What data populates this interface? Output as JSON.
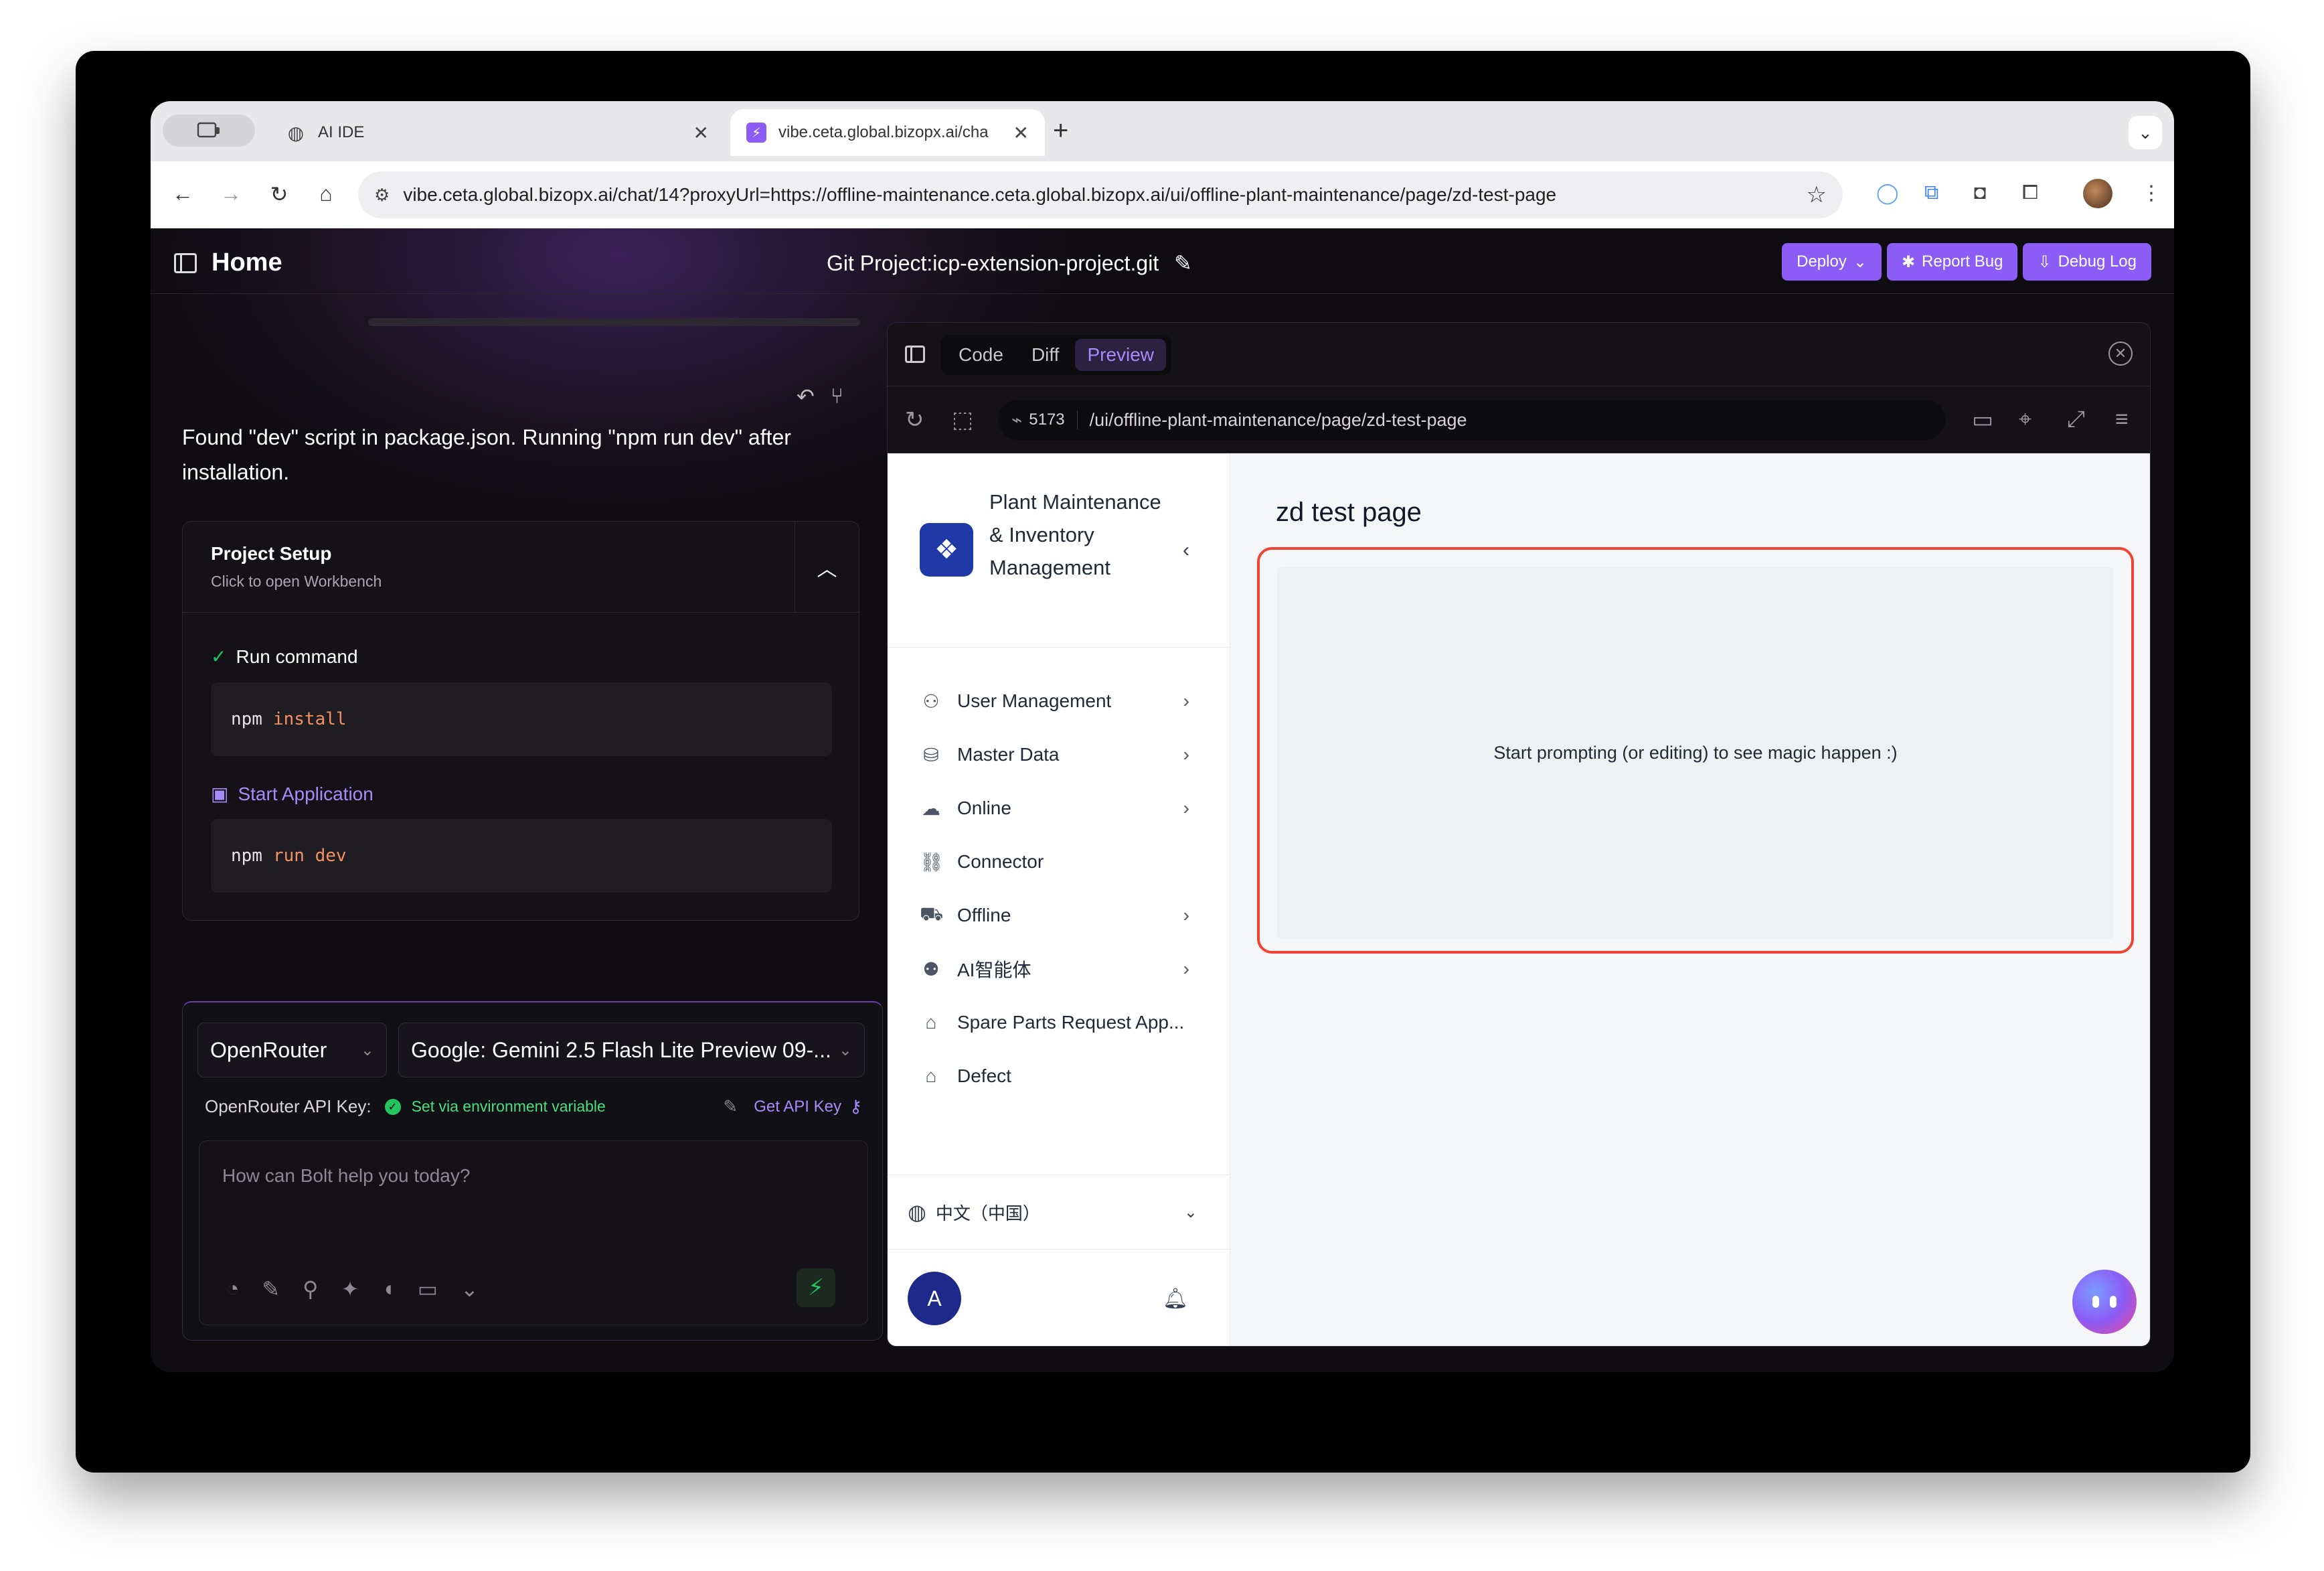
{
  "browser": {
    "tabs": [
      {
        "label": "AI IDE",
        "icon": "globe-icon"
      },
      {
        "label": "vibe.ceta.global.bizopx.ai/cha",
        "icon": "bolt-icon"
      }
    ],
    "url": "vibe.ceta.global.bizopx.ai/chat/14?proxyUrl=https://offline-maintenance.ceta.global.bizopx.ai/ui/offline-plant-maintenance/page/zd-test-page"
  },
  "app": {
    "home_label": "Home",
    "project_title": "Git Project:icp-extension-project.git",
    "buttons": {
      "deploy": "Deploy",
      "report_bug": "Report Bug",
      "debug_log": "Debug Log"
    }
  },
  "chat": {
    "message": "Found \"dev\" script in package.json. Running \"npm run dev\" after installation.",
    "setup": {
      "title": "Project Setup",
      "subtitle": "Click to open Workbench",
      "steps": [
        {
          "label": "Run command",
          "cmd": "npm",
          "args": "install",
          "status": "done"
        },
        {
          "label": "Start Application",
          "cmd": "npm",
          "args": "run dev",
          "status": "running"
        }
      ]
    },
    "provider": "OpenRouter",
    "model": "Google: Gemini 2.5 Flash Lite Preview 09-...",
    "api_key_label": "OpenRouter API Key:",
    "api_key_status": "Set via environment variable",
    "get_api_key": "Get API Key",
    "prompt_placeholder": "How can Bolt help you today?"
  },
  "workbench": {
    "tabs": [
      "Code",
      "Diff",
      "Preview"
    ],
    "active_tab": "Preview",
    "port": "5173",
    "path": "/ui/offline-plant-maintenance/page/zd-test-page"
  },
  "preview": {
    "app_name": "Plant Maintenance & Inventory Management",
    "menu": [
      {
        "label": "User Management",
        "icon": "users-icon",
        "has_children": true
      },
      {
        "label": "Master Data",
        "icon": "database-icon",
        "has_children": true
      },
      {
        "label": "Online",
        "icon": "cloud-icon",
        "has_children": true
      },
      {
        "label": "Connector",
        "icon": "link-icon",
        "has_children": false
      },
      {
        "label": "Offline",
        "icon": "cart-icon",
        "has_children": true
      },
      {
        "label": "AI智能体",
        "icon": "agent-icon",
        "has_children": true
      },
      {
        "label": "Spare Parts Request App...",
        "icon": "home-icon",
        "has_children": false
      },
      {
        "label": "Defect",
        "icon": "home-icon",
        "has_children": false
      }
    ],
    "language": "中文（中国）",
    "user_initial": "A",
    "page_title": "zd test page",
    "placeholder_text": "Start prompting (or editing) to see magic happen :)"
  },
  "colors": {
    "accent": "#8b5cf6",
    "highlight_border": "#ef4433",
    "success": "#22c55e"
  }
}
